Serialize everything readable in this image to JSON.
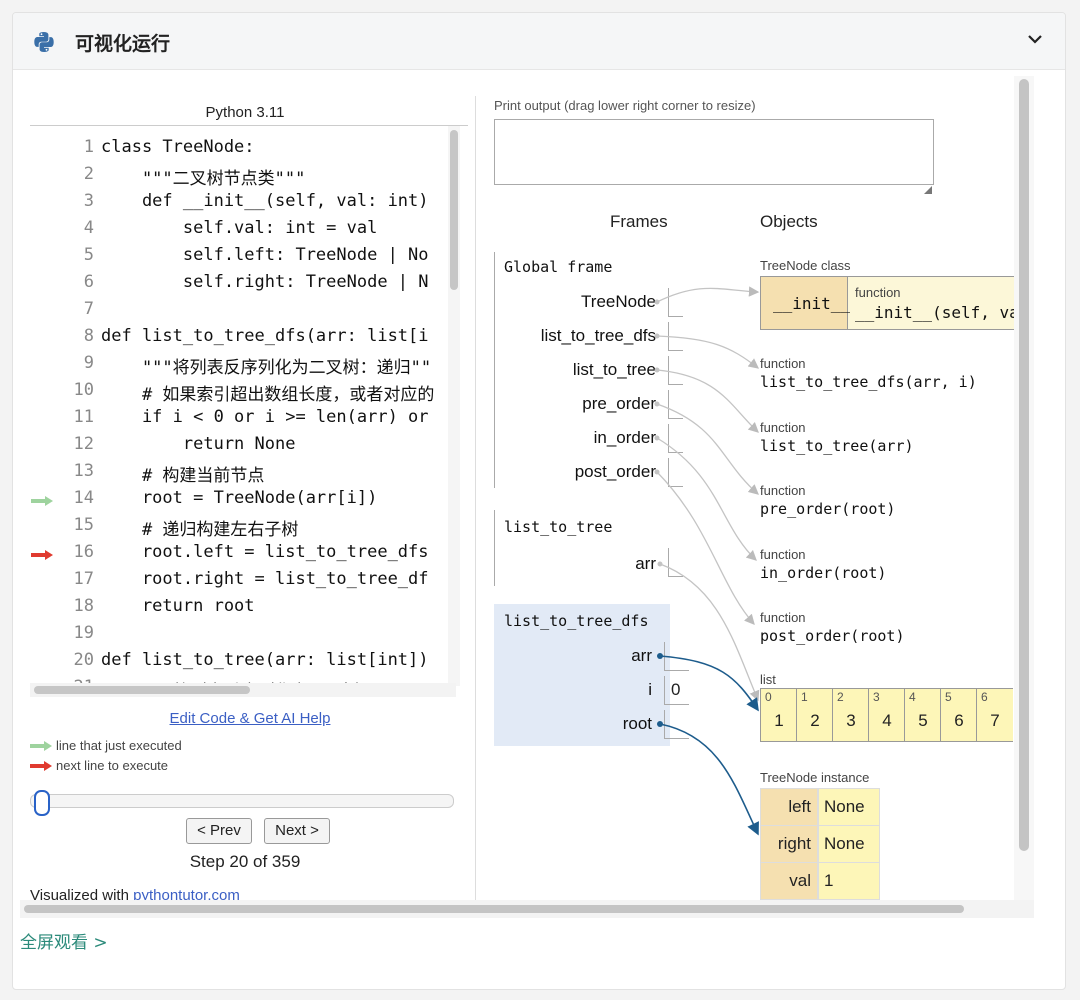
{
  "header": {
    "title": "可视化运行"
  },
  "footer": {
    "fullscreen_label": "全屏观看 >"
  },
  "editor": {
    "python_version": "Python 3.11",
    "lines": [
      {
        "n": "1",
        "t": "class TreeNode:"
      },
      {
        "n": "2",
        "t": "    \"\"\"二叉树节点类\"\"\""
      },
      {
        "n": "3",
        "t": "    def __init__(self, val: int)"
      },
      {
        "n": "4",
        "t": "        self.val: int = val"
      },
      {
        "n": "5",
        "t": "        self.left: TreeNode | No"
      },
      {
        "n": "6",
        "t": "        self.right: TreeNode | N"
      },
      {
        "n": "7",
        "t": ""
      },
      {
        "n": "8",
        "t": "def list_to_tree_dfs(arr: list[i"
      },
      {
        "n": "9",
        "t": "    \"\"\"将列表反序列化为二叉树：递归\"\""
      },
      {
        "n": "10",
        "t": "    # 如果索引超出数组长度，或者对应的"
      },
      {
        "n": "11",
        "t": "    if i < 0 or i >= len(arr) or"
      },
      {
        "n": "12",
        "t": "        return None"
      },
      {
        "n": "13",
        "t": "    # 构建当前节点"
      },
      {
        "n": "14",
        "t": "    root = TreeNode(arr[i])"
      },
      {
        "n": "15",
        "t": "    # 递归构建左右子树"
      },
      {
        "n": "16",
        "t": "    root.left = list_to_tree_dfs"
      },
      {
        "n": "17",
        "t": "    root.right = list_to_tree_df"
      },
      {
        "n": "18",
        "t": "    return root"
      },
      {
        "n": "19",
        "t": ""
      },
      {
        "n": "20",
        "t": "def list_to_tree(arr: list[int])"
      },
      {
        "n": "21",
        "t": "    \"\"\"将列表反序列化为二叉树\"\"\""
      }
    ],
    "just_executed_line": "14",
    "next_line": "16",
    "edit_link": "Edit Code & Get AI Help",
    "legend_just_executed": "line that just executed",
    "legend_next": "next line to execute",
    "prev_label": "< Prev",
    "next_label": "Next >",
    "step_label": "Step 20 of 359",
    "step_current": 20,
    "step_total": 359,
    "visualized_prefix": "Visualized with ",
    "visualized_link": "pythontutor.com",
    "colors": {
      "just_executed": "#9ed39e",
      "next": "#e03a2f",
      "link": "#3b5fc4"
    }
  },
  "viz": {
    "print_label": "Print output (drag lower right corner to resize)",
    "frames_header": "Frames",
    "objects_header": "Objects",
    "global_frame": {
      "name": "Global frame",
      "vars": [
        "TreeNode",
        "list_to_tree_dfs",
        "list_to_tree",
        "pre_order",
        "in_order",
        "post_order"
      ]
    },
    "list_to_tree_frame": {
      "name": "list_to_tree",
      "vars": [
        "arr"
      ]
    },
    "dfs_frame": {
      "name": "list_to_tree_dfs",
      "vars": [
        {
          "name": "arr",
          "value": ""
        },
        {
          "name": "i",
          "value": "0"
        },
        {
          "name": "root",
          "value": ""
        }
      ],
      "highlight_color": "#e2eaf6"
    },
    "class_obj": {
      "label": "TreeNode class",
      "key": "__init__",
      "type": "function",
      "value": "__init__(self, val"
    },
    "functions": [
      {
        "type": "function",
        "sig": "list_to_tree_dfs(arr, i)"
      },
      {
        "type": "function",
        "sig": "list_to_tree(arr)"
      },
      {
        "type": "function",
        "sig": "pre_order(root)"
      },
      {
        "type": "function",
        "sig": "in_order(root)"
      },
      {
        "type": "function",
        "sig": "post_order(root)"
      }
    ],
    "list_obj": {
      "label": "list",
      "indices": [
        "0",
        "1",
        "2",
        "3",
        "4",
        "5",
        "6"
      ],
      "values": [
        "1",
        "2",
        "3",
        "4",
        "5",
        "6",
        "7"
      ]
    },
    "instance": {
      "label": "TreeNode instance",
      "rows": [
        {
          "key": "left",
          "value": "None"
        },
        {
          "key": "right",
          "value": "None"
        },
        {
          "key": "val",
          "value": "1"
        }
      ]
    }
  }
}
